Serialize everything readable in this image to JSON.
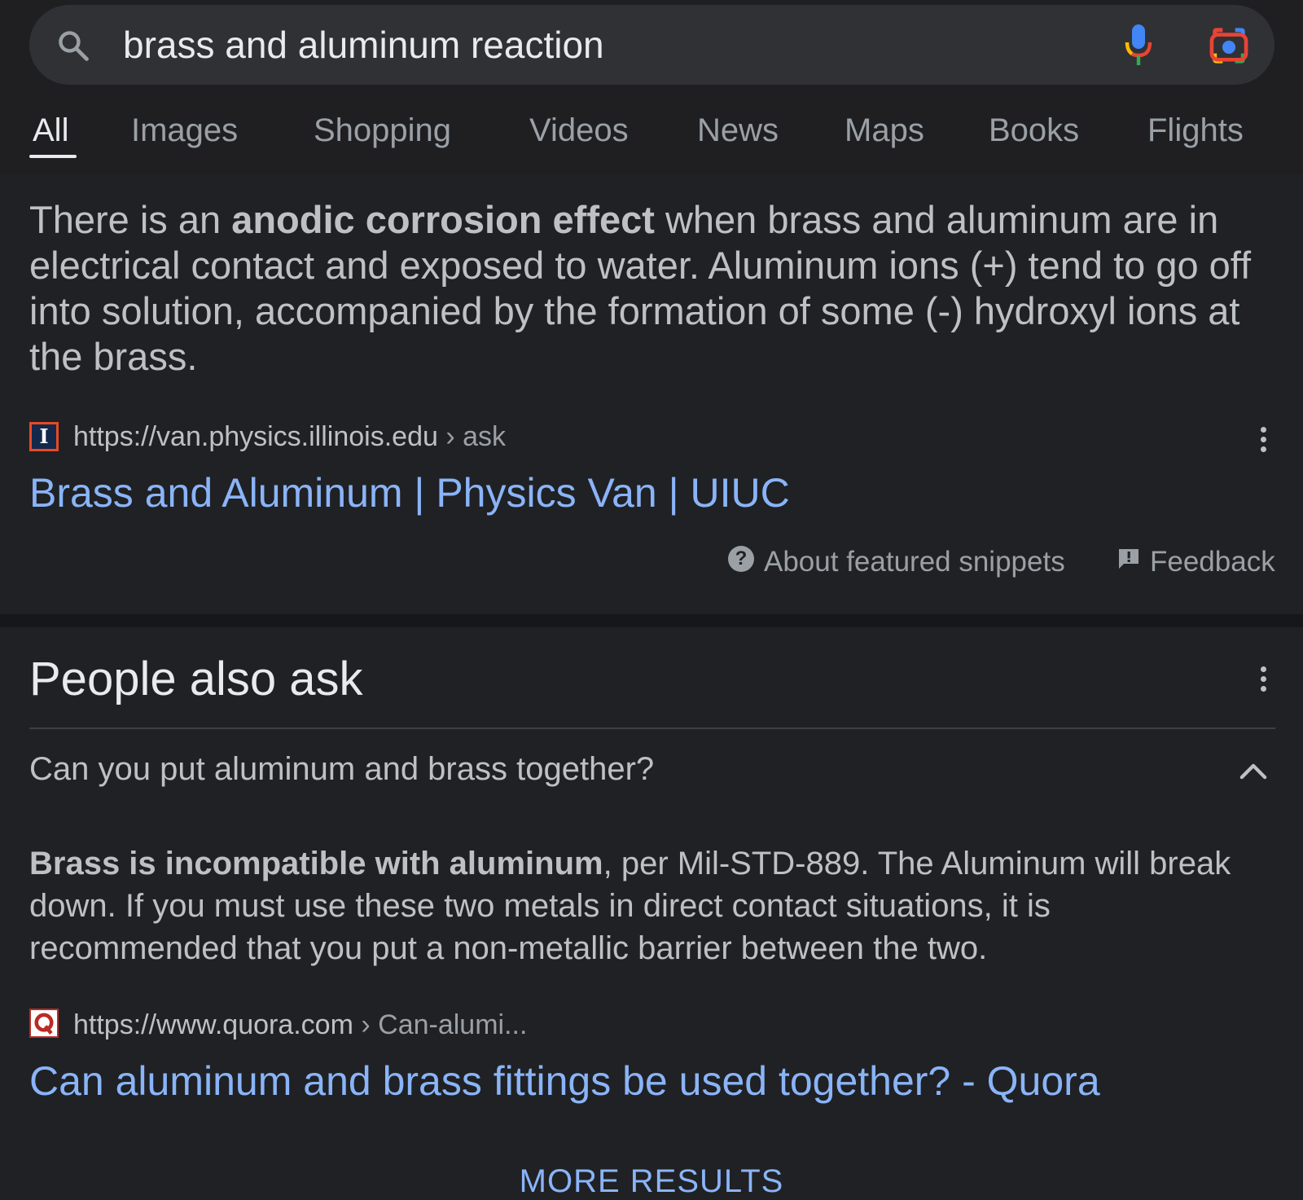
{
  "search": {
    "query": "brass and aluminum reaction"
  },
  "tabs": [
    {
      "label": "All",
      "active": true
    },
    {
      "label": "Images"
    },
    {
      "label": "Shopping"
    },
    {
      "label": "Videos"
    },
    {
      "label": "News"
    },
    {
      "label": "Maps"
    },
    {
      "label": "Books"
    },
    {
      "label": "Flights"
    }
  ],
  "featured_snippet": {
    "text_before": "There is an ",
    "text_bold": "anodic corrosion effect",
    "text_after": " when brass and aluminum are in electrical contact and exposed to water. Aluminum ions (+) tend to go off into solution, accompanied by the formation of some (-) hydroxyl ions at the brass.",
    "source_url": "https://van.physics.illinois.edu",
    "source_crumb": "› ask",
    "favicon_letter": "I",
    "title": "Brass and Aluminum | Physics Van | UIUC",
    "about_label": "About featured snippets",
    "feedback_label": "Feedback"
  },
  "people_also_ask": {
    "heading": "People also ask",
    "question": "Can you put aluminum and brass together?",
    "answer_bold": "Brass is incompatible with aluminum",
    "answer_rest": ", per Mil-STD-889. The Aluminum will break down. If you must use these two metals in direct contact situations, it is recommended that you put a non-metallic barrier between the two.",
    "source_url": "https://www.quora.com",
    "source_crumb": "› Can-alumi...",
    "title": "Can aluminum and brass fittings be used together? - Quora"
  },
  "more_results_label": "MORE RESULTS",
  "colors": {
    "background": "#202124",
    "link": "#8ab4f8",
    "text": "#bdc1c6"
  }
}
